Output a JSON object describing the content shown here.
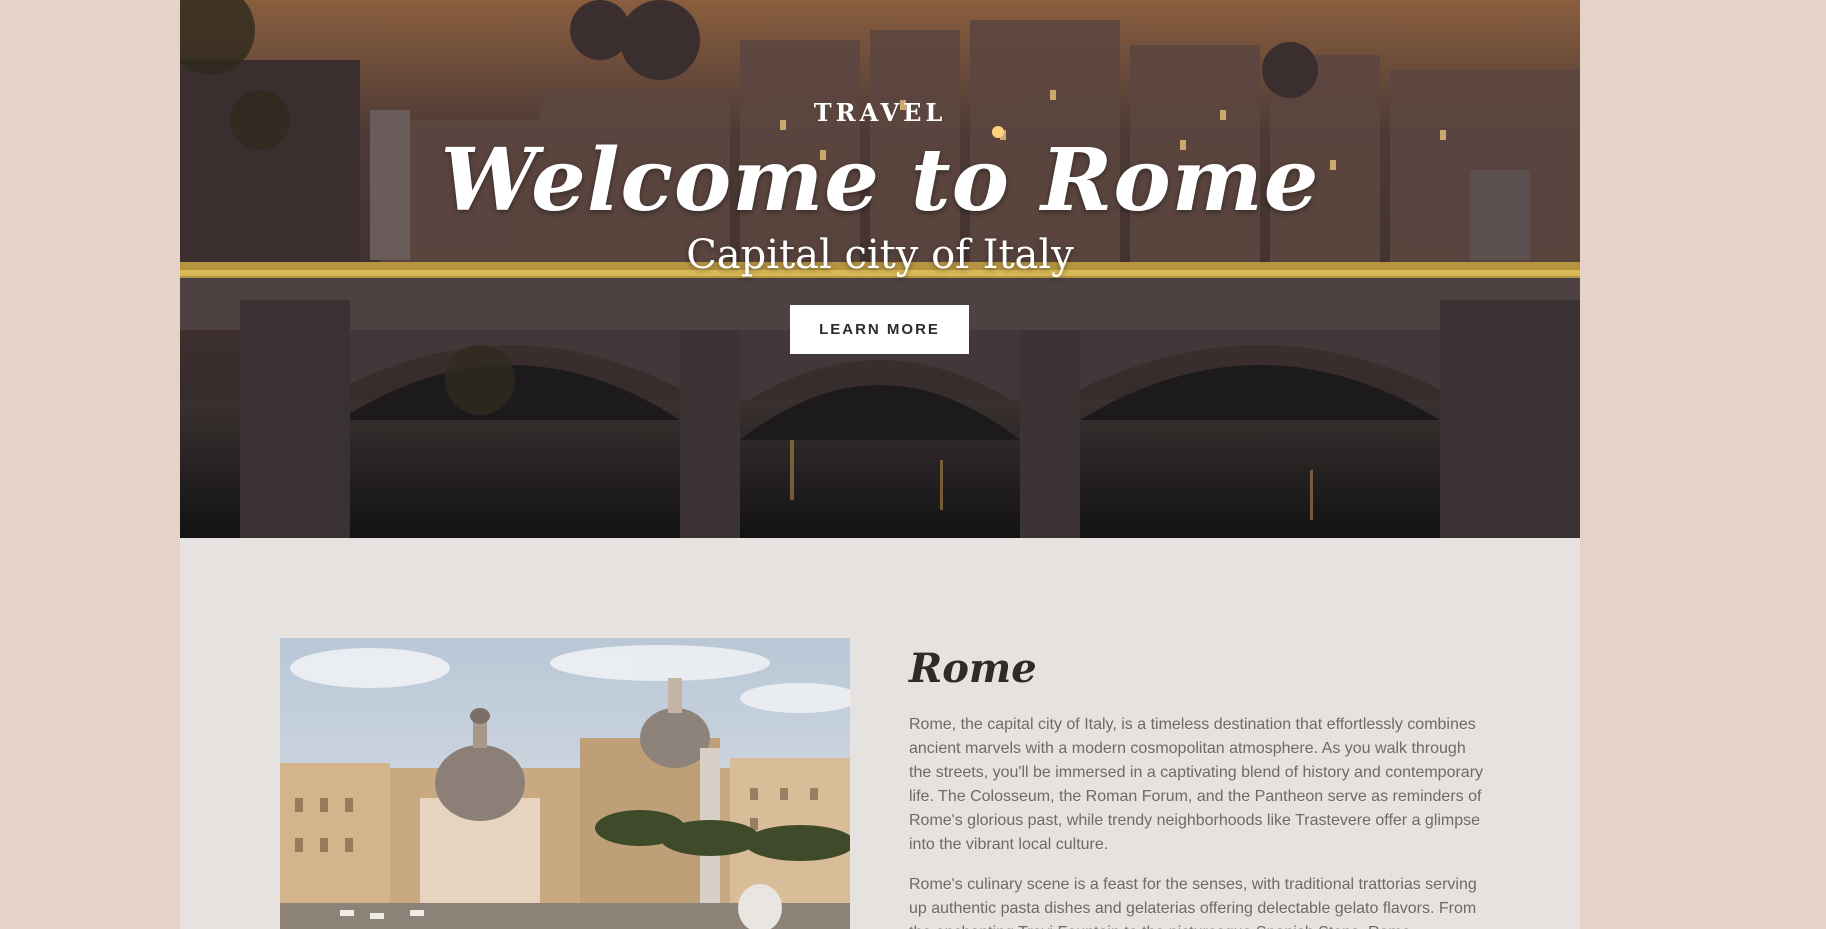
{
  "hero": {
    "eyebrow": "TRAVEL",
    "title": "Welcome to Rome",
    "subtitle": "Capital city of Italy",
    "cta_label": "LEARN MORE"
  },
  "section": {
    "heading": "Rome",
    "paragraphs": [
      "Rome, the capital city of Italy, is a timeless destination that effortlessly combines ancient marvels with a modern cosmopolitan atmosphere. As you walk through the streets, you'll be immersed in a captivating blend of history and contemporary life. The Colosseum, the Roman Forum, and the Pantheon serve as reminders of Rome's glorious past, while trendy neighborhoods like Trastevere offer a glimpse into the vibrant local culture.",
      "Rome's culinary scene is a feast for the senses, with traditional trattorias serving up authentic pasta dishes and gelaterias offering delectable gelato flavors. From the enchanting Trevi Fountain to the picturesque Spanish Steps, Rome captivates"
    ]
  },
  "colors": {
    "page_background": "#e5d3c8",
    "content_background": "#e6e2df",
    "button_background": "#ffffff",
    "body_text": "#6f6a66"
  }
}
